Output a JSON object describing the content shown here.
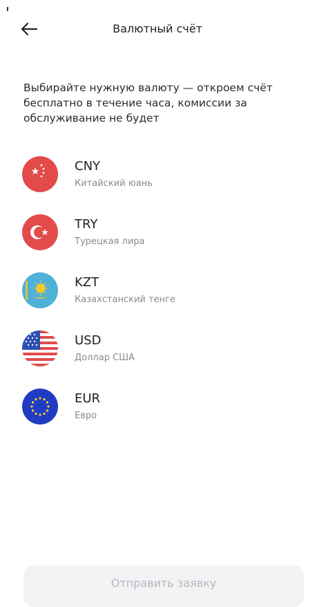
{
  "header": {
    "title": "Валютный счёт",
    "back_icon": "arrow-left-icon"
  },
  "intro_text": "Выбирайте нужную валюту — откроем счёт бесплатно в течение часа, комиссии за обслуживание не будет",
  "currencies": [
    {
      "code": "CNY",
      "name": "Китайский юань",
      "flag_icon": "china-flag-icon"
    },
    {
      "code": "TRY",
      "name": "Турецкая лира",
      "flag_icon": "turkey-flag-icon"
    },
    {
      "code": "KZT",
      "name": "Казахстанский тенге",
      "flag_icon": "kazakhstan-flag-icon"
    },
    {
      "code": "USD",
      "name": "Доллар США",
      "flag_icon": "usa-flag-icon"
    },
    {
      "code": "EUR",
      "name": "Евро",
      "flag_icon": "eu-flag-icon"
    }
  ],
  "submit_label": "Отправить заявку",
  "colors": {
    "text_primary": "#1f1f24",
    "text_secondary": "#8a8a90",
    "button_disabled_bg": "#f2f3f5",
    "button_disabled_text": "#b7b7bd"
  }
}
